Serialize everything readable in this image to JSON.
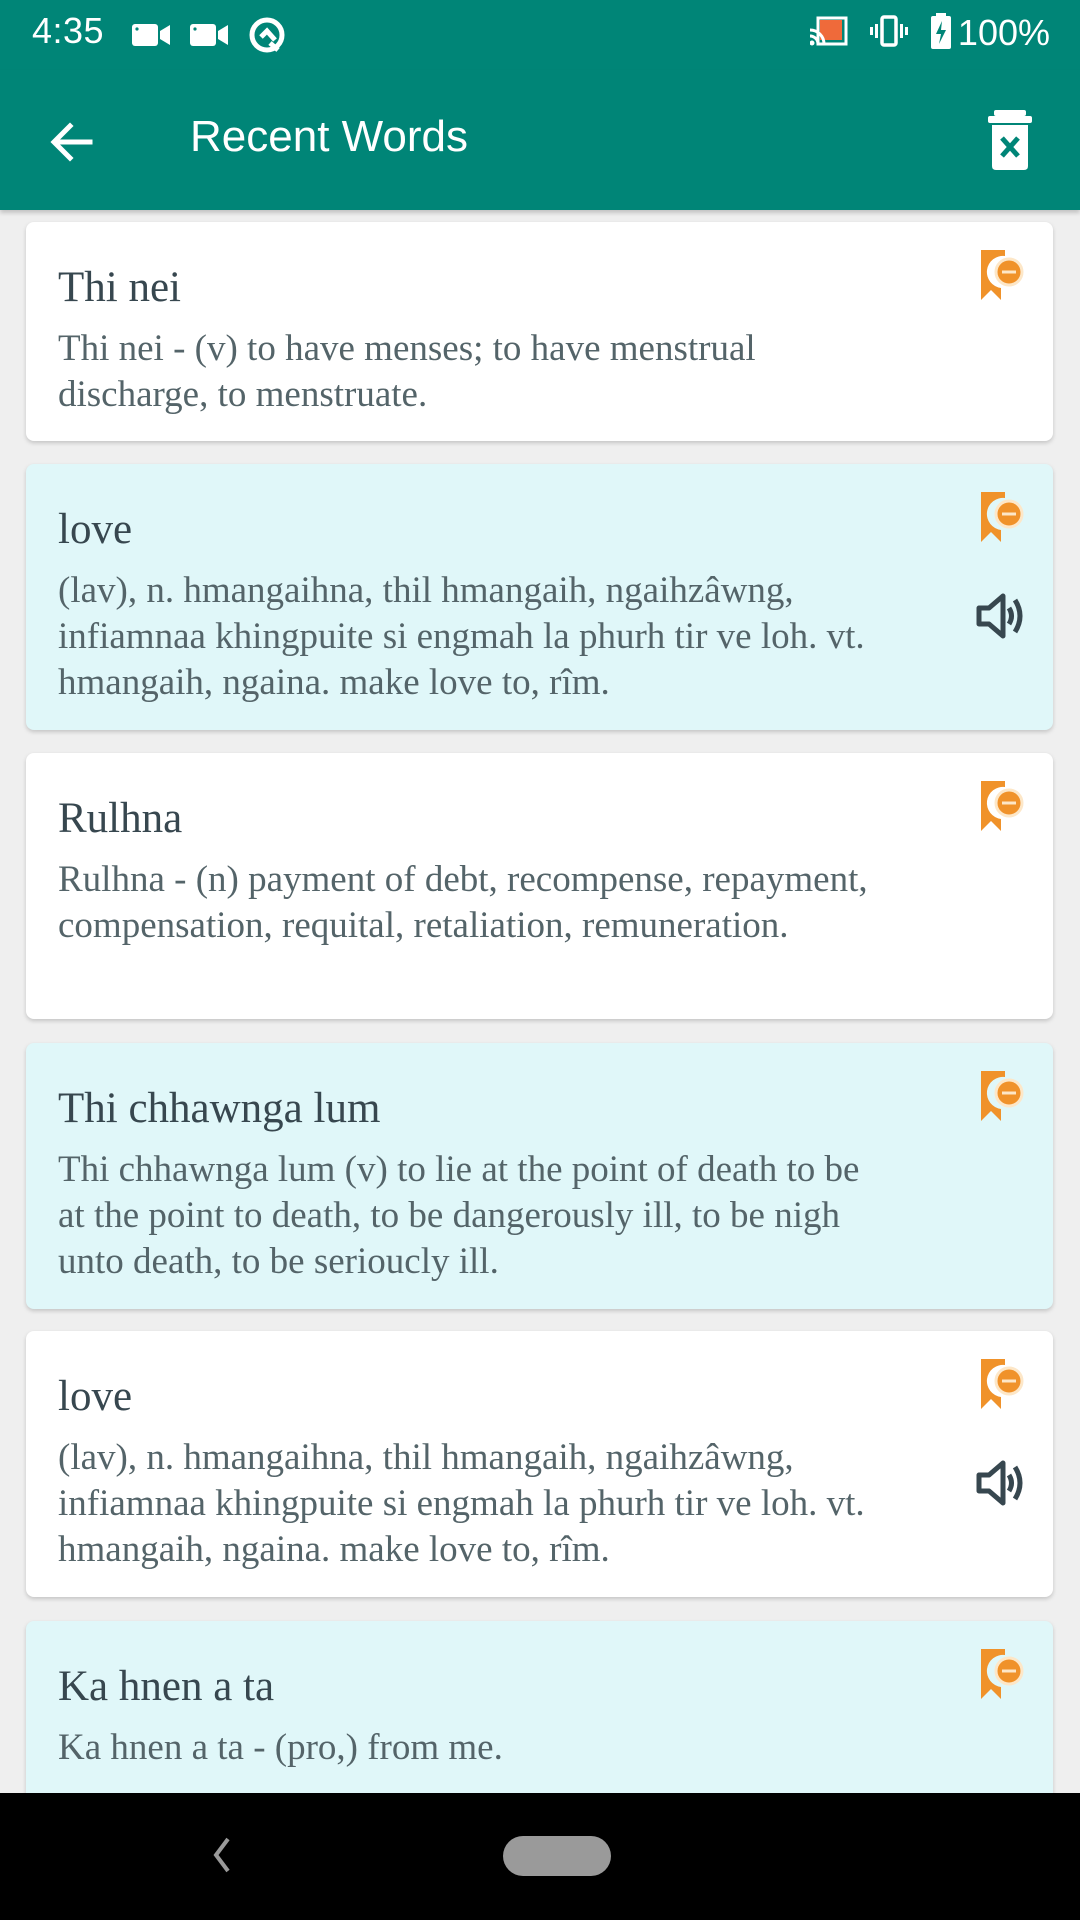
{
  "status_bar": {
    "time": "4:35",
    "battery_text": "100%",
    "left_icons": [
      "video-camera-icon",
      "video-camera-icon",
      "q-beta-icon"
    ],
    "right_icons": [
      "cast-icon",
      "vibrate-icon",
      "battery-charging-icon"
    ]
  },
  "toolbar": {
    "title": "Recent Words",
    "back_icon": "arrow-back-icon",
    "action_icon": "delete-all-icon"
  },
  "colors": {
    "primary": "#008577",
    "card_alt": "#e0f7f9",
    "bookmark": "#f0922a",
    "speaker": "#37474f"
  },
  "words": [
    {
      "word": "Thi nei",
      "definition": "Thi nei - (v) to have menses; to have menstrual discharge, to menstruate.",
      "has_audio": false
    },
    {
      "word": "love",
      "definition": "(lav), n. hmangaihna, thil hmangaih, ngaihzâwng, infiamnaa khingpuite si engmah la phurh tir ve loh. vt. hmangaih, ngaina.  make love to, rîm.",
      "has_audio": true
    },
    {
      "word": "Rulhna",
      "definition": "Rulhna - (n) payment of debt, recompense, repayment, compensation, requital, retaliation, remuneration.",
      "has_audio": false
    },
    {
      "word": "Thi chhawnga lum",
      "definition": "Thi chhawnga lum (v) to lie at the point of death to be at the point to death, to be dangerously ill, to be nigh unto death, to be serioucly ill.",
      "has_audio": false
    },
    {
      "word": "love",
      "definition": "(lav), n. hmangaihna, thil hmangaih, ngaihzâwng, infiamnaa khingpuite si engmah la phurh tir ve loh. vt. hmangaih, ngaina.  make love to, rîm.",
      "has_audio": true
    },
    {
      "word": "Ka hnen a ta",
      "definition": "Ka hnen a ta - (pro,) from me.",
      "has_audio": false
    }
  ],
  "nav_bar": {
    "back_icon": "nav-back-icon",
    "home_icon": "nav-home-pill"
  }
}
